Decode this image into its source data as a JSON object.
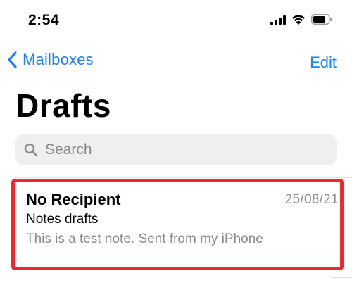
{
  "status_bar": {
    "time": "2:54",
    "icons": [
      "cellular-signal-icon",
      "wifi-icon",
      "battery-icon"
    ]
  },
  "nav": {
    "back_label": "Mailboxes",
    "edit_label": "Edit"
  },
  "title": "Drafts",
  "search": {
    "placeholder": "Search"
  },
  "messages": [
    {
      "sender": "No Recipient",
      "date": "25/08/21",
      "subject": "Notes drafts",
      "preview": "This is a test note. Sent from my iPhone",
      "highlighted": true
    }
  ],
  "colors": {
    "accent": "#1a82f7",
    "secondary_text": "#8a8a8e",
    "search_background": "#efeff0",
    "highlight_border": "#f0282d"
  }
}
